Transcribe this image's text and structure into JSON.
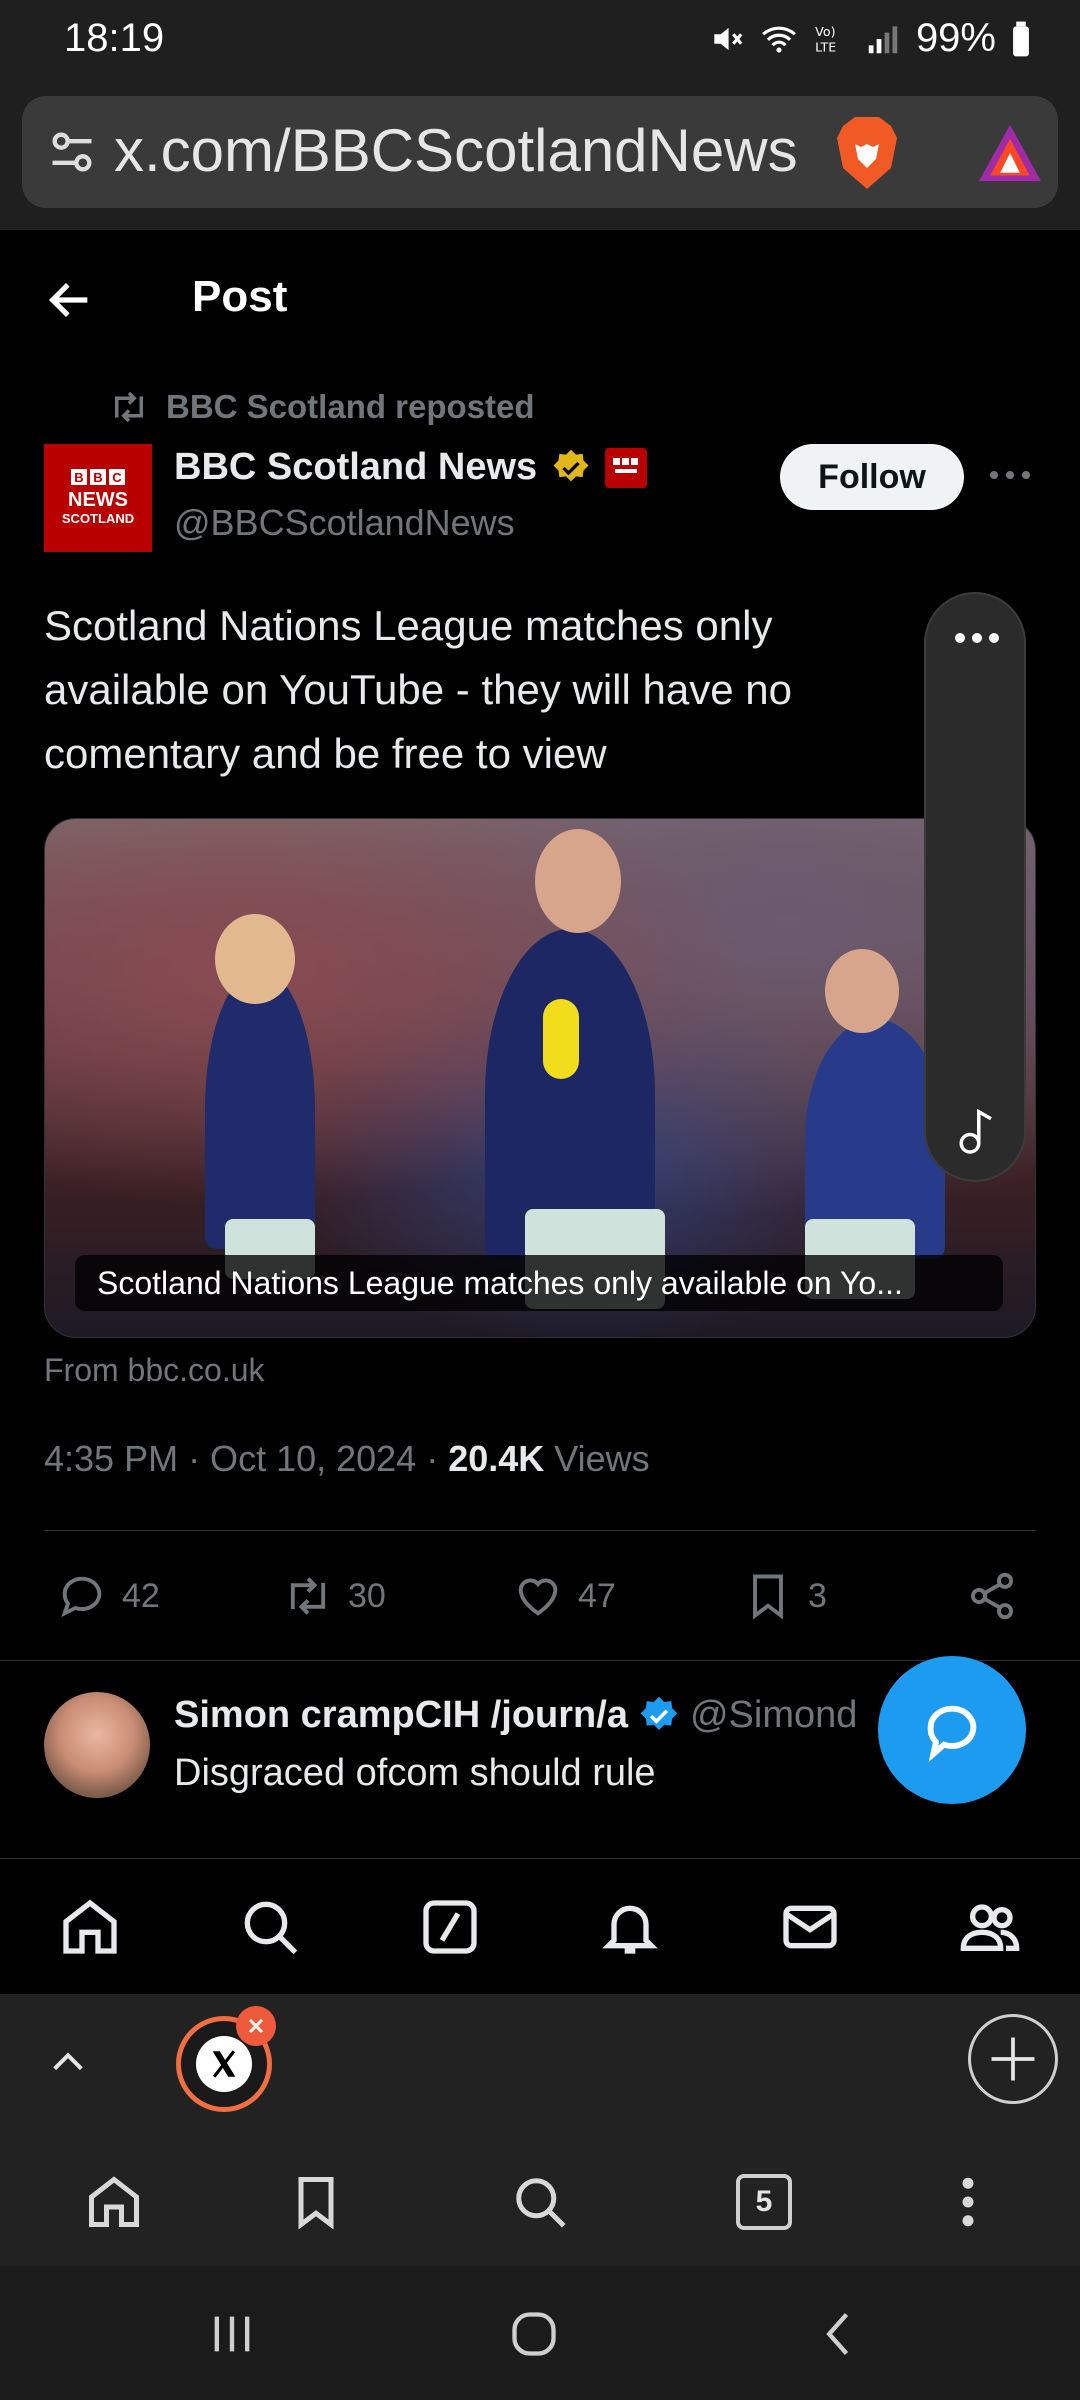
{
  "status_bar": {
    "time": "18:19",
    "battery": "99%",
    "icons": [
      "mute-icon",
      "wifi-icon",
      "volte-icon",
      "signal-icon",
      "battery-icon"
    ]
  },
  "browser": {
    "url": "x.com/BBCScotlandNews",
    "open_tab_count": "5"
  },
  "post_header": {
    "title": "Post"
  },
  "post": {
    "repost_label": "BBC Scotland reposted",
    "author_name": "BBC Scotland News",
    "author_handle": "@BBCScotlandNews",
    "avatar_text": {
      "line1": "NEWS",
      "line2": "SCOTLAND",
      "letters": [
        "B",
        "B",
        "C"
      ]
    },
    "follow_label": "Follow",
    "text": "Scotland Nations League matches only available on YouTube - they will have no comentary and be free to view",
    "media_caption": "Scotland Nations League matches only available on Yo...",
    "source": "From bbc.co.uk",
    "timestamp": "4:35 PM · Oct 10, 2024 · ",
    "views_count": "20.4K",
    "views_label": " Views",
    "stats": {
      "replies": "42",
      "reposts": "30",
      "likes": "47",
      "bookmarks": "3"
    }
  },
  "reply": {
    "name": "Simon crampCIH /journ/a",
    "handle": "@Simond",
    "text": "Disgraced ofcom should rule"
  },
  "colors": {
    "accent": "#1d9bf0",
    "bbc_red": "#b80000",
    "verified_gold": "#e2b719",
    "tab_ring": "#f06e40"
  }
}
